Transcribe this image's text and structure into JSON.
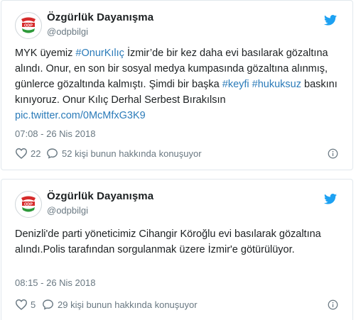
{
  "tweets": [
    {
      "author": "Özgürlük Dayanışma",
      "handle": "@odpbilgi",
      "text_segments": [
        {
          "t": "MYK üyemiz ",
          "link": false
        },
        {
          "t": "#OnurKılıç",
          "link": true
        },
        {
          "t": " İzmir’de bir kez daha evi basılarak gözaltına alındı. Onur, en son bir sosyal medya kumpasında gözaltına alınmış, günlerce gözaltında kalmıştı. Şimdi bir başka ",
          "link": false
        },
        {
          "t": "#keyfi",
          "link": true
        },
        {
          "t": " ",
          "link": false
        },
        {
          "t": "#hukuksuz",
          "link": true
        },
        {
          "t": " baskını kınıyoruz. Onur Kılıç Derhal Serbest Bırakılsın ",
          "link": false
        },
        {
          "t": "pic.twitter.com/0McMfxG3K9",
          "link": true
        }
      ],
      "timestamp": "07:08 - 26 Nis 2018",
      "likes": "22",
      "conversation": "52 kişi bunun hakkında konuşuyor"
    },
    {
      "author": "Özgürlük Dayanışma",
      "handle": "@odpbilgi",
      "text_segments": [
        {
          "t": "Denizli'de parti yöneticimiz Cihangir Köroğlu evi basılarak gözaltına alındı.Polis tarafından sorgulanmak üzere İzmir'e götürülüyor.",
          "link": false
        }
      ],
      "timestamp": "08:15 - 26 Nis 2018",
      "likes": "5",
      "conversation": "29 kişi bunun hakkında konuşuyor"
    }
  ],
  "avatar_logo_text": "ODP",
  "icons": {
    "bird": "twitter-bird-icon",
    "heart": "heart-icon",
    "reply": "reply-bubble-icon",
    "info": "info-icon"
  },
  "colors": {
    "link": "#2b7bb9",
    "twitter_blue": "#1da1f2",
    "muted": "#697882",
    "border": "#e1e8ed",
    "logo_red": "#d62b2b",
    "logo_green": "#2e9a3a"
  }
}
